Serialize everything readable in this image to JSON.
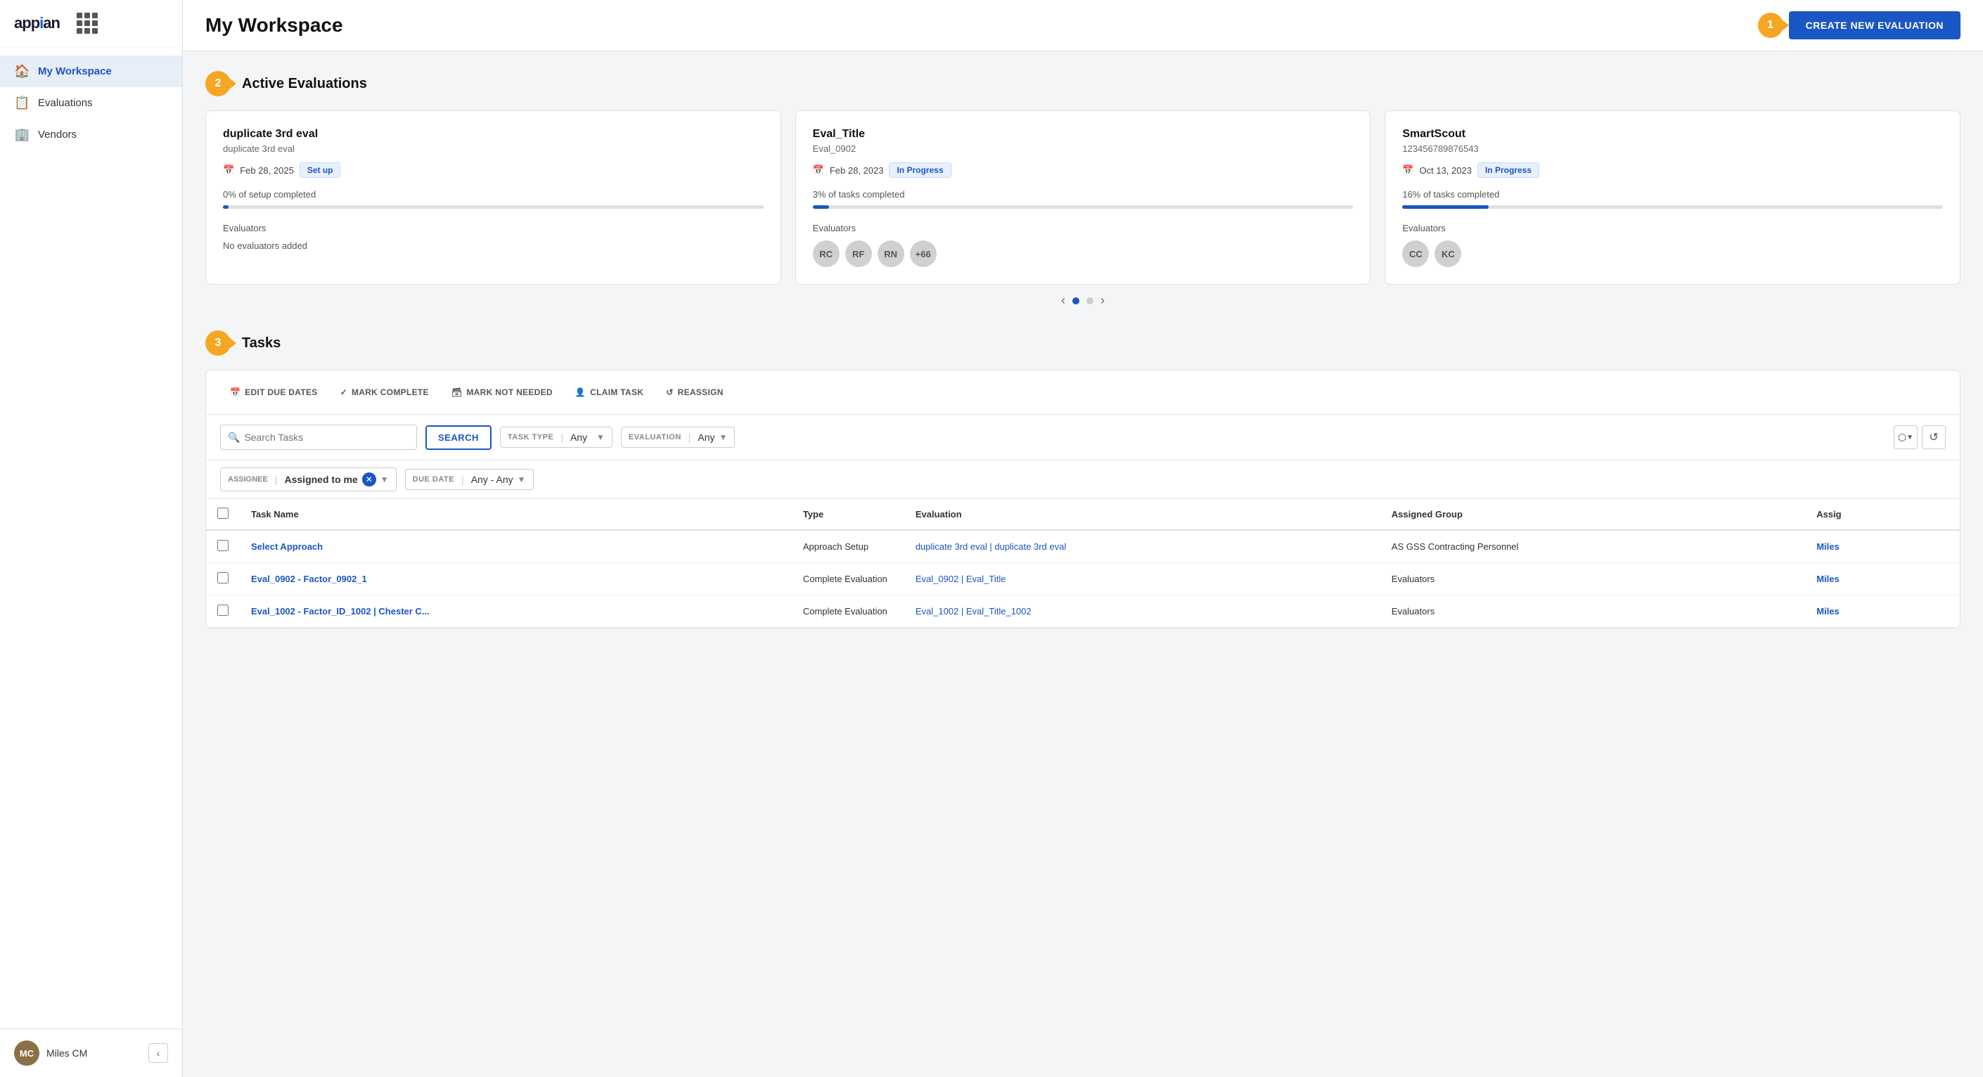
{
  "app": {
    "logo": "appian",
    "title": "My Workspace"
  },
  "sidebar": {
    "nav_items": [
      {
        "id": "my-workspace",
        "label": "My Workspace",
        "icon": "🏠",
        "active": true
      },
      {
        "id": "evaluations",
        "label": "Evaluations",
        "icon": "📋",
        "active": false
      },
      {
        "id": "vendors",
        "label": "Vendors",
        "icon": "🏢",
        "active": false
      }
    ],
    "user": {
      "name": "Miles CM",
      "initials": "MC"
    },
    "collapse_label": "<"
  },
  "header": {
    "title": "My Workspace",
    "create_btn_label": "CREATE NEW EVALUATION",
    "step_number": "1"
  },
  "active_evaluations": {
    "section_title": "Active Evaluations",
    "step_number": "2",
    "cards": [
      {
        "title": "duplicate 3rd eval",
        "subtitle": "duplicate 3rd eval",
        "date": "Feb 28, 2025",
        "status": "Set up",
        "status_class": "status-setup",
        "progress_text": "0% of setup completed",
        "progress_class": "progress-0",
        "evaluators_label": "Evaluators",
        "evaluators_empty": "No evaluators added",
        "avatars": []
      },
      {
        "title": "Eval_Title",
        "subtitle": "Eval_0902",
        "date": "Feb 28, 2023",
        "status": "In Progress",
        "status_class": "status-progress",
        "progress_text": "3% of tasks completed",
        "progress_class": "progress-3",
        "evaluators_label": "Evaluators",
        "evaluators_empty": "",
        "avatars": [
          "RC",
          "RF",
          "RN",
          "+66"
        ]
      },
      {
        "title": "SmartScout",
        "subtitle": "123456789876543",
        "date": "Oct 13, 2023",
        "status": "In Progress",
        "status_class": "status-progress",
        "progress_text": "16% of tasks completed",
        "progress_class": "progress-16",
        "evaluators_label": "Evaluators",
        "evaluators_empty": "",
        "avatars": [
          "CC",
          "KC"
        ]
      }
    ],
    "pagination": {
      "prev": "‹",
      "next": "›"
    }
  },
  "tasks": {
    "section_title": "Tasks",
    "step_number": "3",
    "toolbar": {
      "buttons": [
        {
          "id": "edit-due-dates",
          "icon": "📅",
          "label": "EDIT DUE DATES"
        },
        {
          "id": "mark-complete",
          "icon": "✓",
          "label": "MARK COMPLETE"
        },
        {
          "id": "mark-not-needed",
          "icon": "🗃",
          "label": "MARK NOT NEEDED"
        },
        {
          "id": "claim-task",
          "icon": "👤",
          "label": "CLAIM TASK"
        },
        {
          "id": "reassign",
          "icon": "↺",
          "label": "REASSIGN"
        }
      ]
    },
    "search": {
      "placeholder": "Search Tasks",
      "button_label": "SEARCH"
    },
    "filters": {
      "task_type_label": "TASK TYPE",
      "task_type_value": "Any",
      "evaluation_label": "EVALUATION",
      "evaluation_value": "Any",
      "assignee_label": "ASSIGNEE",
      "assignee_value": "Assigned to me",
      "due_date_label": "DUE DATE",
      "due_date_value": "Any - Any"
    },
    "table": {
      "columns": [
        "Task Name",
        "Type",
        "Evaluation",
        "Assigned Group",
        "Assig"
      ],
      "rows": [
        {
          "task_name": "Select Approach",
          "type": "Approach Setup",
          "evaluation": "duplicate 3rd eval | duplicate 3rd eval",
          "assigned_group": "AS GSS Contracting Personnel",
          "assignee": "Miles"
        },
        {
          "task_name": "Eval_0902 - Factor_0902_1",
          "type": "Complete Evaluation",
          "evaluation": "Eval_0902 | Eval_Title",
          "assigned_group": "Evaluators",
          "assignee": "Miles"
        },
        {
          "task_name": "Eval_1002 - Factor_ID_1002 | Chester C...",
          "type": "Complete Evaluation",
          "evaluation": "Eval_1002 | Eval_Title_1002",
          "assigned_group": "Evaluators",
          "assignee": "Miles"
        }
      ]
    }
  }
}
